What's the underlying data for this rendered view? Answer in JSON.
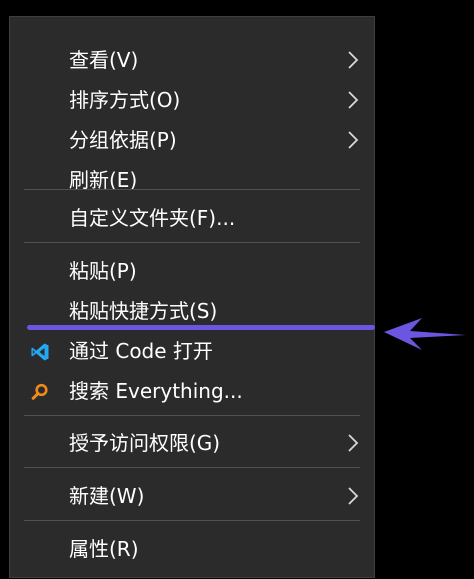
{
  "menu": {
    "items": [
      {
        "label": "查看(V)",
        "submenu": true
      },
      {
        "label": "排序方式(O)",
        "submenu": true
      },
      {
        "label": "分组依据(P)",
        "submenu": true
      },
      {
        "label": "刷新(E)",
        "submenu": false
      },
      {
        "label": "自定义文件夹(F)...",
        "submenu": false
      },
      {
        "label": "粘贴(P)",
        "submenu": false
      },
      {
        "label": "粘贴快捷方式(S)",
        "submenu": false
      },
      {
        "label": "通过 Code 打开",
        "submenu": false,
        "icon": "vscode-icon"
      },
      {
        "label": "搜索 Everything...",
        "submenu": false,
        "icon": "search-icon"
      },
      {
        "label": "授予访问权限(G)",
        "submenu": true
      },
      {
        "label": "新建(W)",
        "submenu": true
      },
      {
        "label": "属性(R)",
        "submenu": false
      }
    ]
  },
  "colors": {
    "menu_background": "#2b2b2b",
    "text": "#ffffff",
    "separator": "#505050",
    "annotation": "#6a56e0",
    "vscode_blue": "#23a9f2",
    "search_orange": "#f08a1c"
  },
  "annotation": {
    "marker": "underline-under-paste-shortcut",
    "arrow_icon": "pointer-arrow-icon"
  }
}
